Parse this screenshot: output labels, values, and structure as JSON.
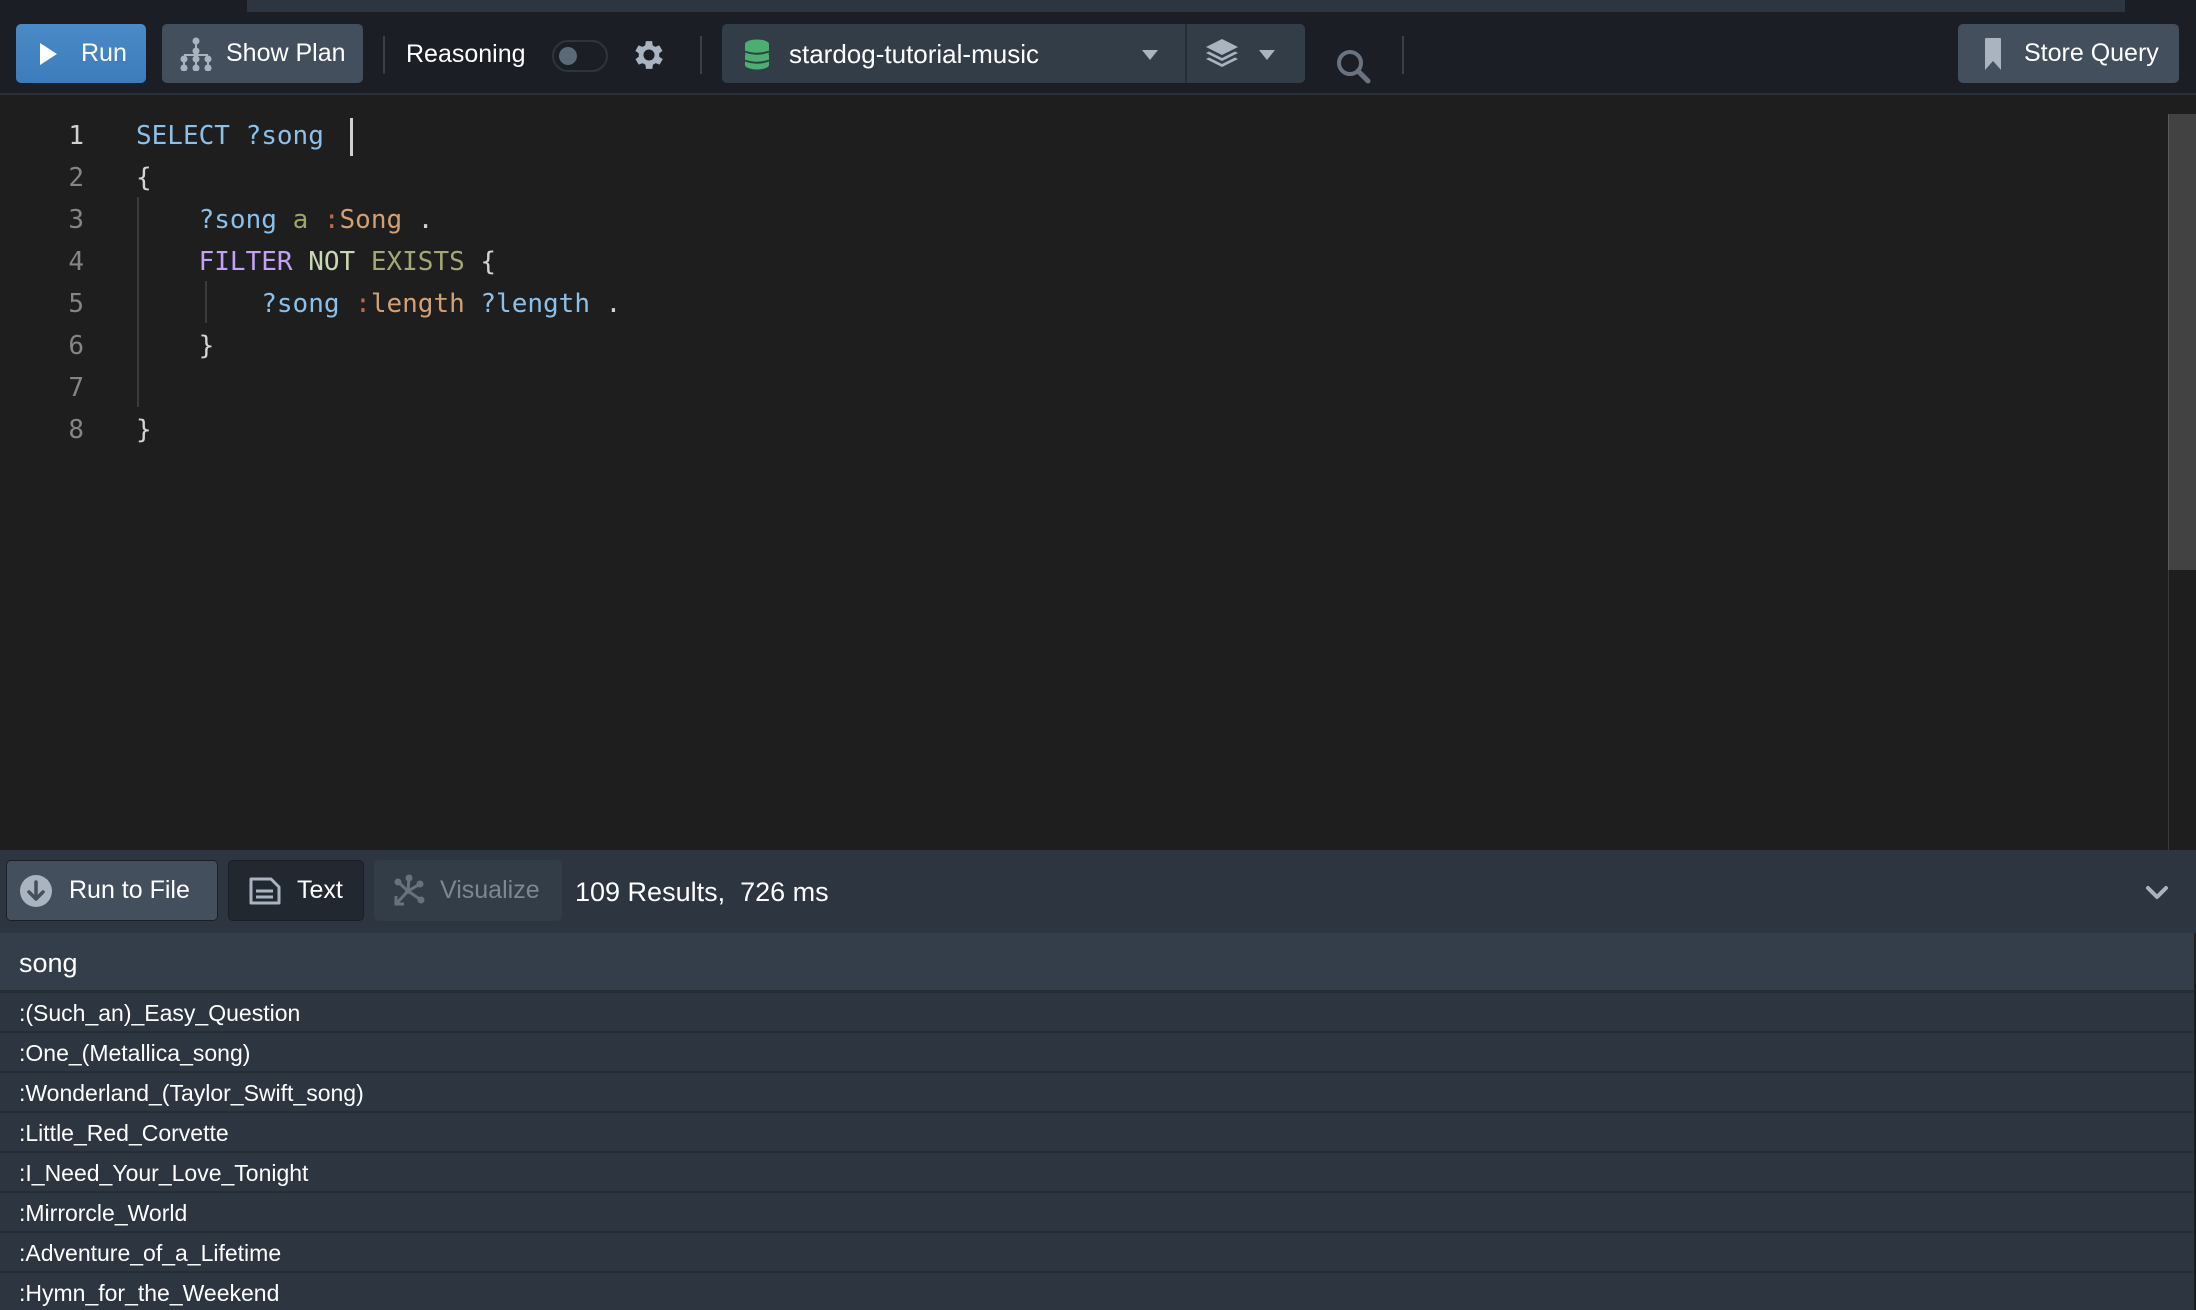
{
  "toolbar": {
    "run_label": "Run",
    "show_plan_label": "Show Plan",
    "reasoning_label": "Reasoning",
    "reasoning_enabled": false,
    "database": "stardog-tutorial-music",
    "store_query_label": "Store Query"
  },
  "editor": {
    "lines": [
      {
        "n": "1",
        "tokens": [
          [
            "kw-blue",
            "SELECT"
          ],
          [
            "punct",
            " "
          ],
          [
            "var",
            "?song"
          ],
          [
            "punct",
            " "
          ]
        ],
        "cursor": true
      },
      {
        "n": "2",
        "tokens": [
          [
            "punct",
            "{"
          ]
        ]
      },
      {
        "n": "3",
        "tokens": [
          [
            "punct",
            "    "
          ],
          [
            "var",
            "?song"
          ],
          [
            "punct",
            " "
          ],
          [
            "kw-a",
            "a"
          ],
          [
            "punct",
            " "
          ],
          [
            "colon",
            ":"
          ],
          [
            "iri",
            "Song"
          ],
          [
            "punct",
            " ."
          ]
        ]
      },
      {
        "n": "4",
        "tokens": [
          [
            "punct",
            "    "
          ],
          [
            "kw-filter",
            "FILTER"
          ],
          [
            "punct",
            " "
          ],
          [
            "kw-not",
            "NOT"
          ],
          [
            "punct",
            " "
          ],
          [
            "kw-exists",
            "EXISTS"
          ],
          [
            "punct",
            " {"
          ]
        ]
      },
      {
        "n": "5",
        "tokens": [
          [
            "punct",
            "        "
          ],
          [
            "var",
            "?song"
          ],
          [
            "punct",
            " "
          ],
          [
            "colon",
            ":"
          ],
          [
            "iri",
            "length"
          ],
          [
            "punct",
            " "
          ],
          [
            "var",
            "?length"
          ],
          [
            "punct",
            " ."
          ]
        ]
      },
      {
        "n": "6",
        "tokens": [
          [
            "punct",
            "    }"
          ]
        ]
      },
      {
        "n": "7",
        "tokens": []
      },
      {
        "n": "8",
        "tokens": [
          [
            "punct",
            "}"
          ]
        ]
      }
    ]
  },
  "results": {
    "run_to_file_label": "Run to File",
    "text_label": "Text",
    "visualize_label": "Visualize",
    "status": "109 Results,  726 ms",
    "columns": [
      "song"
    ],
    "rows": [
      ":(Such_an)_Easy_Question",
      ":One_(Metallica_song)",
      ":Wonderland_(Taylor_Swift_song)",
      ":Little_Red_Corvette",
      ":I_Need_Your_Love_Tonight",
      ":Mirrorcle_World",
      ":Adventure_of_a_Lifetime",
      ":Hymn_for_the_Weekend"
    ]
  }
}
